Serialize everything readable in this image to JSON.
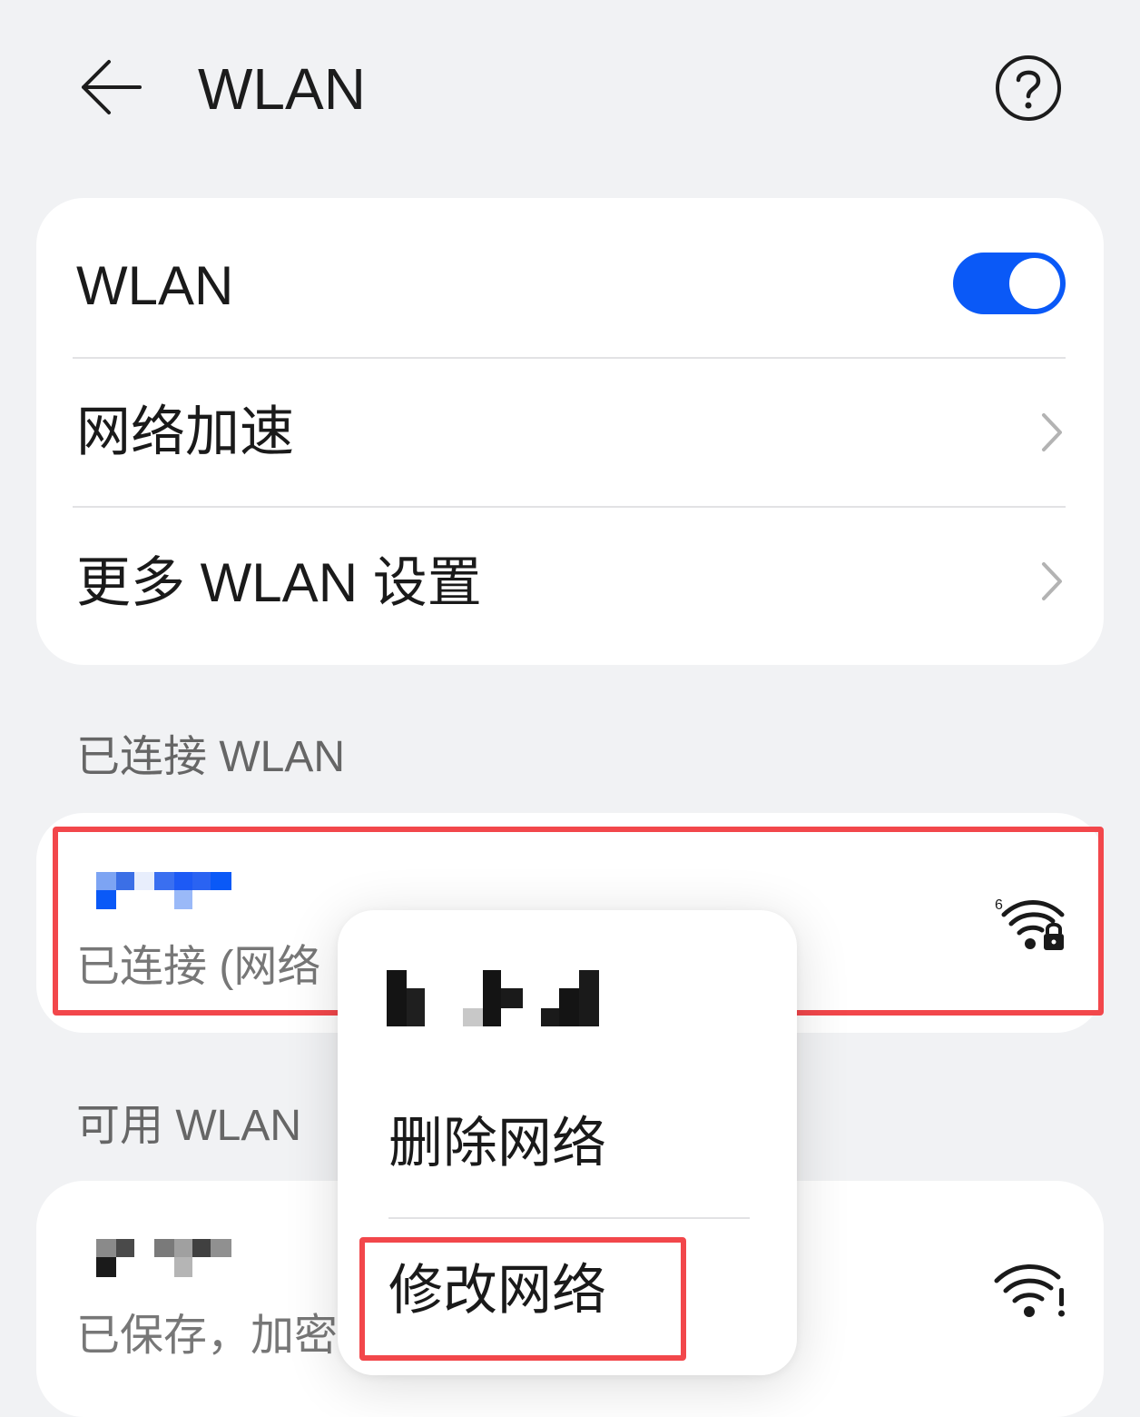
{
  "header": {
    "title": "WLAN",
    "back_icon": "arrow-left-icon",
    "help_icon": "question-circle-icon"
  },
  "settings_card": {
    "wlan_label": "WLAN",
    "wlan_enabled": true,
    "network_accel_label": "网络加速",
    "more_settings_label": "更多 WLAN 设置"
  },
  "connected_section": {
    "title": "已连接 WLAN",
    "network": {
      "status_text": "已连接 (网络",
      "signal_icon": "wifi6-locked-icon"
    }
  },
  "available_section": {
    "title": "可用 WLAN",
    "network": {
      "status_text": "已保存，加密",
      "signal_icon": "wifi-warning-icon"
    }
  },
  "context_menu": {
    "delete_label": "删除网络",
    "modify_label": "修改网络"
  },
  "colors": {
    "accent": "#0a59f7",
    "background": "#f1f2f4",
    "highlight": "#f2474b"
  }
}
